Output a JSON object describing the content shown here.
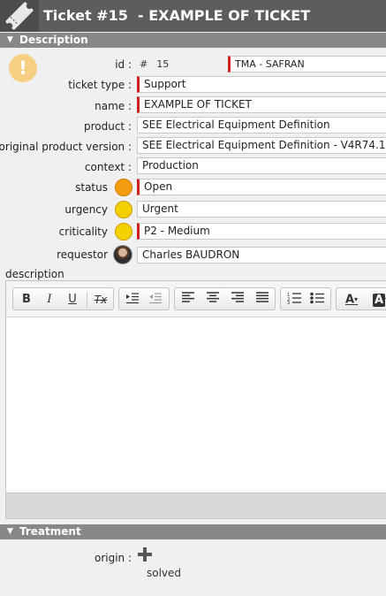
{
  "window": {
    "title": "Ticket #15  - EXAMPLE OF TICKET"
  },
  "sections": {
    "description": "Description",
    "treatment": "Treatment"
  },
  "fields": {
    "id": {
      "label": "id :",
      "hash": "#",
      "value": "15",
      "organization": "TMA - SAFRAN"
    },
    "ticket_type": {
      "label": "ticket type :",
      "value": "Support"
    },
    "name": {
      "label": "name :",
      "value": "EXAMPLE OF TICKET"
    },
    "product": {
      "label": "product :",
      "value": "SEE Electrical Equipment Definition"
    },
    "original_product_version": {
      "label": "original product version :",
      "value": "SEE Electrical Equipment Definition - V4R74.1"
    },
    "context": {
      "label": "context :",
      "value": "Production"
    },
    "status": {
      "label": "status",
      "value": "Open",
      "color": "#f39c12"
    },
    "urgency": {
      "label": "urgency",
      "value": "Urgent",
      "color": "#f5d000"
    },
    "criticality": {
      "label": "criticality",
      "value": "P2 - Medium",
      "color": "#f5d000"
    },
    "requestor": {
      "label": "requestor",
      "value": "Charles BAUDRON"
    }
  },
  "description": {
    "label": "description",
    "toolbar": {
      "bold": "B",
      "italic": "I",
      "underline": "U",
      "clear_format": "Tx",
      "text_color": "A",
      "bg_color": "A"
    }
  },
  "treatment": {
    "origin_label": "origin :",
    "origin_value": "solved"
  },
  "icons": [
    "ticket-icon",
    "warning-icon",
    "bold-icon",
    "italic-icon",
    "underline-icon",
    "clear-format-icon",
    "indent-icon",
    "outdent-icon",
    "align-left-icon",
    "align-center-icon",
    "align-right-icon",
    "justify-icon",
    "numbered-list-icon",
    "bulleted-list-icon",
    "text-color-icon",
    "background-color-icon",
    "plus-icon"
  ]
}
